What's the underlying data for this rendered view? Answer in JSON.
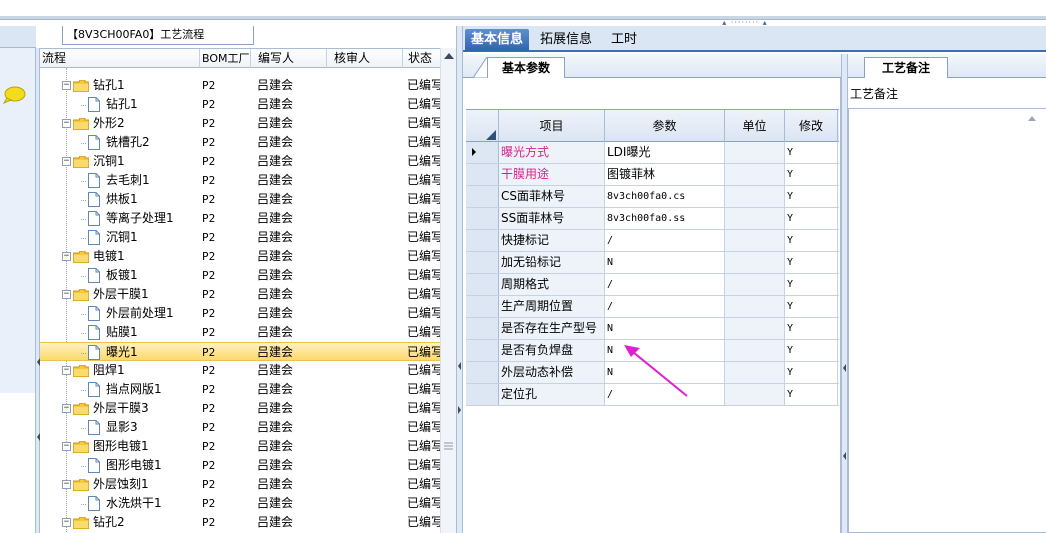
{
  "tree_panel": {
    "title": "【8V3CH00FA0】工艺流程",
    "columns": [
      "流程",
      "BOM工厂",
      "编写人",
      "核审人",
      "状态"
    ],
    "rows": [
      {
        "level": 1,
        "type": "folder",
        "name": "钻孔1",
        "bom": "P2",
        "writer": "吕建会",
        "reviewer": "",
        "status": "已编写"
      },
      {
        "level": 2,
        "type": "doc",
        "name": "钻孔1",
        "bom": "P2",
        "writer": "吕建会",
        "reviewer": "",
        "status": "已编写"
      },
      {
        "level": 1,
        "type": "folder",
        "name": "外形2",
        "bom": "P2",
        "writer": "吕建会",
        "reviewer": "",
        "status": "已编写"
      },
      {
        "level": 2,
        "type": "doc",
        "name": "铣槽孔2",
        "bom": "P2",
        "writer": "吕建会",
        "reviewer": "",
        "status": "已编写"
      },
      {
        "level": 1,
        "type": "folder",
        "name": "沉铜1",
        "bom": "P2",
        "writer": "吕建会",
        "reviewer": "",
        "status": "已编写"
      },
      {
        "level": 2,
        "type": "doc",
        "name": "去毛刺1",
        "bom": "P2",
        "writer": "吕建会",
        "reviewer": "",
        "status": "已编写"
      },
      {
        "level": 2,
        "type": "doc",
        "name": "烘板1",
        "bom": "P2",
        "writer": "吕建会",
        "reviewer": "",
        "status": "已编写"
      },
      {
        "level": 2,
        "type": "doc",
        "name": "等离子处理1",
        "bom": "P2",
        "writer": "吕建会",
        "reviewer": "",
        "status": "已编写"
      },
      {
        "level": 2,
        "type": "doc",
        "name": "沉铜1",
        "bom": "P2",
        "writer": "吕建会",
        "reviewer": "",
        "status": "已编写"
      },
      {
        "level": 1,
        "type": "folder",
        "name": "电镀1",
        "bom": "P2",
        "writer": "吕建会",
        "reviewer": "",
        "status": "已编写"
      },
      {
        "level": 2,
        "type": "doc",
        "name": "板镀1",
        "bom": "P2",
        "writer": "吕建会",
        "reviewer": "",
        "status": "已编写"
      },
      {
        "level": 1,
        "type": "folder",
        "name": "外层干膜1",
        "bom": "P2",
        "writer": "吕建会",
        "reviewer": "",
        "status": "已编写"
      },
      {
        "level": 2,
        "type": "doc",
        "name": "外层前处理1",
        "bom": "P2",
        "writer": "吕建会",
        "reviewer": "",
        "status": "已编写"
      },
      {
        "level": 2,
        "type": "doc",
        "name": "贴膜1",
        "bom": "P2",
        "writer": "吕建会",
        "reviewer": "",
        "status": "已编写"
      },
      {
        "level": 2,
        "type": "doc",
        "name": "曝光1",
        "bom": "P2",
        "writer": "吕建会",
        "reviewer": "",
        "status": "已编写",
        "selected": true
      },
      {
        "level": 1,
        "type": "folder",
        "name": "阻焊1",
        "bom": "P2",
        "writer": "吕建会",
        "reviewer": "",
        "status": "已编写"
      },
      {
        "level": 2,
        "type": "doc",
        "name": "挡点网版1",
        "bom": "P2",
        "writer": "吕建会",
        "reviewer": "",
        "status": "已编写"
      },
      {
        "level": 1,
        "type": "folder",
        "name": "外层干膜3",
        "bom": "P2",
        "writer": "吕建会",
        "reviewer": "",
        "status": "已编写"
      },
      {
        "level": 2,
        "type": "doc",
        "name": "显影3",
        "bom": "P2",
        "writer": "吕建会",
        "reviewer": "",
        "status": "已编写"
      },
      {
        "level": 1,
        "type": "folder",
        "name": "图形电镀1",
        "bom": "P2",
        "writer": "吕建会",
        "reviewer": "",
        "status": "已编写"
      },
      {
        "level": 2,
        "type": "doc",
        "name": "图形电镀1",
        "bom": "P2",
        "writer": "吕建会",
        "reviewer": "",
        "status": "已编写"
      },
      {
        "level": 1,
        "type": "folder",
        "name": "外层蚀刻1",
        "bom": "P2",
        "writer": "吕建会",
        "reviewer": "",
        "status": "已编写"
      },
      {
        "level": 2,
        "type": "doc",
        "name": "水洗烘干1",
        "bom": "P2",
        "writer": "吕建会",
        "reviewer": "",
        "status": "已编写"
      },
      {
        "level": 1,
        "type": "folder",
        "name": "钻孔2",
        "bom": "P2",
        "writer": "吕建会",
        "reviewer": "",
        "status": "已编写"
      }
    ]
  },
  "tabs": [
    {
      "label": "基本信息",
      "active": true
    },
    {
      "label": "拓展信息",
      "active": false
    },
    {
      "label": "工时",
      "active": false
    }
  ],
  "basic_panel": {
    "tab_label": "基本参数",
    "columns": [
      "项目",
      "参数",
      "单位",
      "修改"
    ],
    "rows": [
      {
        "item": "曝光方式",
        "param": "LDI曝光",
        "unit": "",
        "modify": "Y",
        "highlight": true,
        "current": true
      },
      {
        "item": "干膜用途",
        "param": "图镀菲林",
        "unit": "",
        "modify": "Y",
        "highlight": true
      },
      {
        "item": "CS面菲林号",
        "param": "8v3ch00fa0.cs",
        "unit": "",
        "modify": "Y"
      },
      {
        "item": "SS面菲林号",
        "param": "8v3ch00fa0.ss",
        "unit": "",
        "modify": "Y"
      },
      {
        "item": "快捷标记",
        "param": "/",
        "unit": "",
        "modify": "Y"
      },
      {
        "item": "加无铅标记",
        "param": "N",
        "unit": "",
        "modify": "Y"
      },
      {
        "item": "周期格式",
        "param": "/",
        "unit": "",
        "modify": "Y"
      },
      {
        "item": "生产周期位置",
        "param": "/",
        "unit": "",
        "modify": "Y"
      },
      {
        "item": "是否存在生产型号",
        "param": "N",
        "unit": "",
        "modify": "Y"
      },
      {
        "item": "是否有负焊盘",
        "param": "N",
        "unit": "",
        "modify": "Y"
      },
      {
        "item": "外层动态补偿",
        "param": "N",
        "unit": "",
        "modify": "Y"
      },
      {
        "item": "定位孔",
        "param": "/",
        "unit": "",
        "modify": "Y"
      }
    ]
  },
  "remark_panel": {
    "tab_label": "工艺备注",
    "field_label": "工艺备注"
  },
  "colors": {
    "highlight_text": "#d4268a",
    "annotation_arrow": "#e020d0",
    "active_tab": "#2f63ad",
    "selection": "#fcd96b"
  },
  "icons": [
    "chat-bubble-icon",
    "folder-icon",
    "document-icon",
    "expand-collapse-icon",
    "row-pointer-icon",
    "scroll-up-icon"
  ]
}
